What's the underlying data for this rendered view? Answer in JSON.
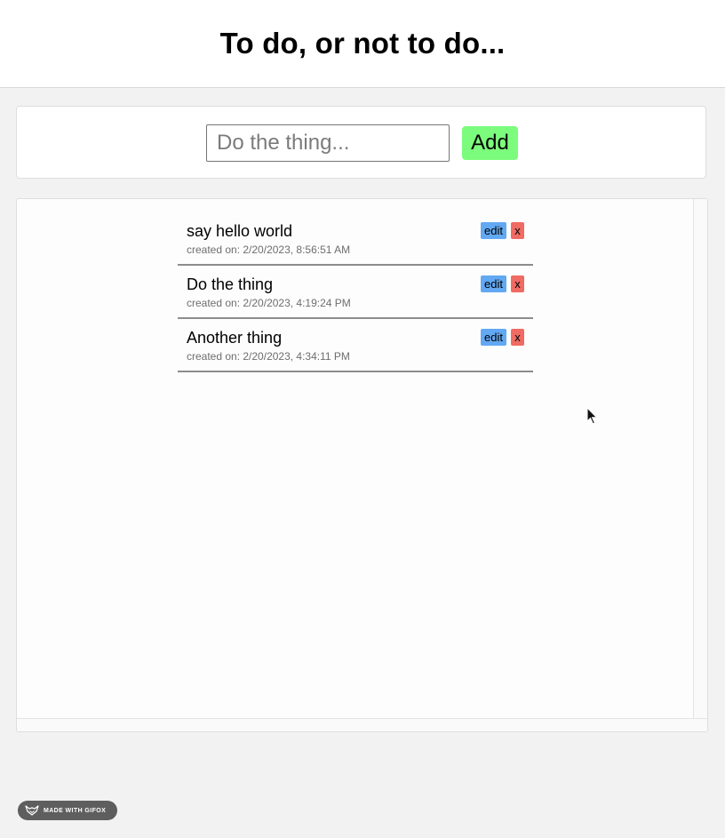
{
  "header": {
    "title": "To do, or not to do..."
  },
  "add_form": {
    "placeholder": "Do the thing...",
    "value": "",
    "add_label": "Add",
    "add_color": "#7cfc7c"
  },
  "todos": [
    {
      "text": "say hello world",
      "created": "created on: 2/20/2023, 8:56:51 AM",
      "edit_label": "edit",
      "delete_label": "x"
    },
    {
      "text": "Do the thing",
      "created": "created on: 2/20/2023, 4:19:24 PM",
      "edit_label": "edit",
      "delete_label": "x"
    },
    {
      "text": "Another thing",
      "created": "created on: 2/20/2023, 4:34:11 PM",
      "edit_label": "edit",
      "delete_label": "x"
    }
  ],
  "colors": {
    "edit": "#62a8f2",
    "delete": "#ef6b63",
    "background": "#f2f2f2"
  },
  "badge": {
    "label": "MADE WITH GIFOX",
    "icon": "fox-icon"
  },
  "pointer": {
    "icon": "arrow-cursor-icon"
  }
}
